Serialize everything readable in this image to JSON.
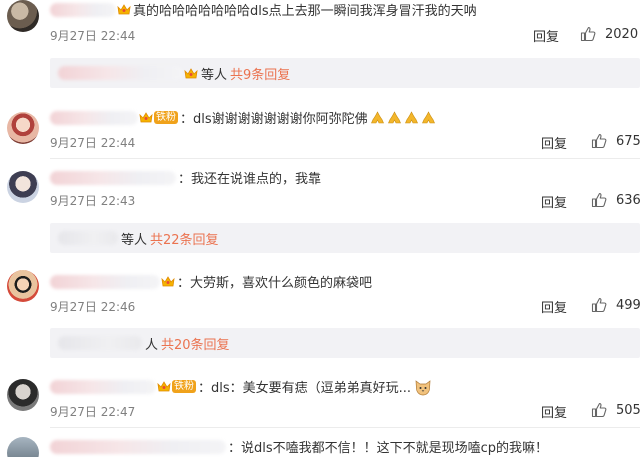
{
  "comments": [
    {
      "badge": "",
      "text": "真的哈哈哈哈哈哈哈dls点上去那一瞬间我浑身冒汗我的天呐",
      "time": "9月27日 22:44",
      "reply": "回复",
      "likes": "2020"
    },
    {
      "badge": "铁粉",
      "text": "dls谢谢谢谢谢谢谢你阿弥陀佛",
      "time": "9月27日 22:44",
      "reply": "回复",
      "likes": "675"
    },
    {
      "badge": "",
      "text": "我还在说谁点的，我靠",
      "time": "9月27日 22:43",
      "reply": "回复",
      "likes": "636"
    },
    {
      "badge": "",
      "text": "大劳斯，喜欢什么颜色的麻袋吧",
      "time": "9月27日 22:46",
      "reply": "回复",
      "likes": "499"
    },
    {
      "badge": "铁粉",
      "text": "dls：美女要有痣（逗弟弟真好玩...",
      "time": "9月27日 22:47",
      "reply": "回复",
      "likes": "505"
    },
    {
      "badge": "",
      "text": "说dls不嗑我都不信！！这下不就是现场嗑cp的我嘛！",
      "time": "",
      "reply": "",
      "likes": ""
    }
  ],
  "reply_threads": [
    {
      "who": "等人",
      "count": "共9条回复"
    },
    {
      "who": "等人",
      "count": "共22条回复"
    },
    {
      "who": "人",
      "count": "共20条回复"
    }
  ],
  "colors": {
    "count_link": "#eb7350",
    "fan_badge": "#f0a21b",
    "time": "#808080",
    "thread_bg": "#f2f2f5"
  },
  "icons": [
    "crown-icon",
    "thumbs-up-icon",
    "praying-hands-icon",
    "cat-emoji-icon"
  ]
}
